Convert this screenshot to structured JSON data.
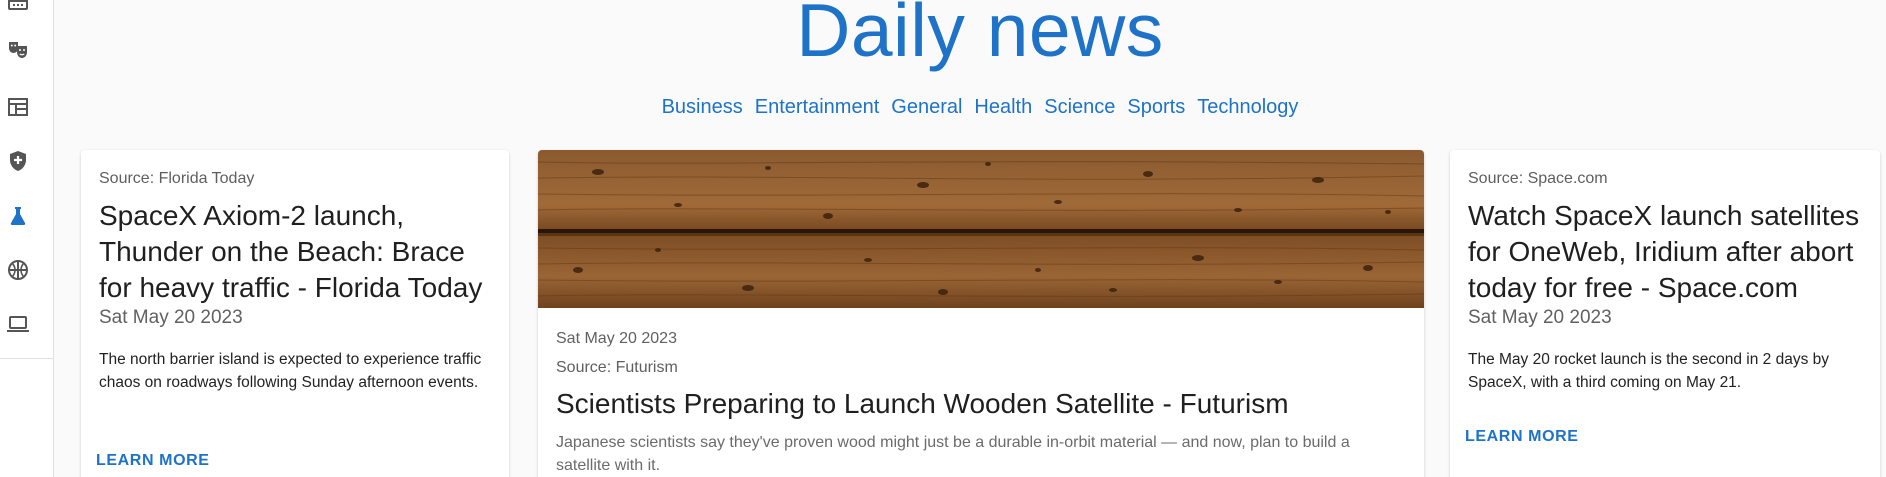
{
  "page": {
    "title": "Daily news"
  },
  "nav": {
    "rail_icons": [
      "business-icon",
      "entertainment-icon",
      "general-icon",
      "health-icon",
      "science-icon",
      "sports-icon",
      "technology-icon"
    ]
  },
  "categories": [
    "Business",
    "Entertainment",
    "General",
    "Health",
    "Science",
    "Sports",
    "Technology"
  ],
  "articles": [
    {
      "source": "Source: Florida Today",
      "title": "SpaceX Axiom-2 launch, Thunder on the Beach: Brace for heavy traffic - Florida Today",
      "date": "Sat May 20 2023",
      "description": "The north barrier island is expected to experience traffic chaos on roadways following Sunday afternoon events.",
      "cta": "LEARN MORE"
    },
    {
      "date": "Sat May 20 2023",
      "source": "Source: Futurism",
      "title": "Scientists Preparing to Launch Wooden Satellite - Futurism",
      "description": "Japanese scientists say they've proven wood might just be a durable in-orbit material — and now, plan to build a satellite with it.",
      "image": "wooden-planks-image"
    },
    {
      "source": "Source: Space.com",
      "title": "Watch SpaceX launch satellites for OneWeb, Iridium after abort today for free - Space.com",
      "date": "Sat May 20 2023",
      "description": "The May 20 rocket launch is the second in 2 days by SpaceX, with a third coming on May 21.",
      "cta": "LEARN MORE"
    }
  ],
  "colors": {
    "accent": "#1e73c8",
    "icon": "#555555",
    "active_icon": "#1e73c8"
  }
}
